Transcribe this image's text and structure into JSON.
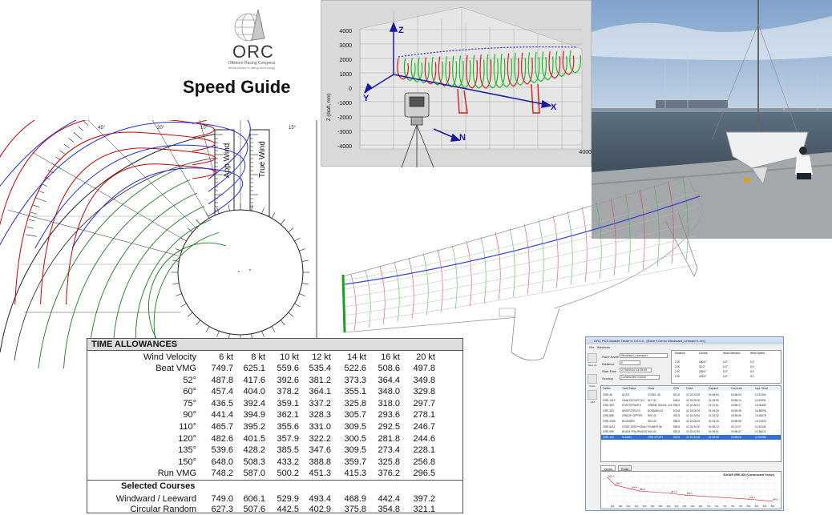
{
  "logo": {
    "brand": "ORC",
    "line1": "Offshore Racing Congress",
    "line2": "World leader in rating technology"
  },
  "title": "Speed Guide",
  "polar": {
    "angle_labels": [
      "45°",
      "20°",
      "10°",
      "15°"
    ],
    "scale_labels": [
      "App Wind",
      "True Wind"
    ],
    "colors": {
      "wind_speed_curves": "#cc0000",
      "angle_curves": "#1a7a1a",
      "apparent_curves": "#1e2fd0"
    }
  },
  "scan": {
    "axis_z_title": "Z (draft, mm)",
    "y_ticks": [
      "4000",
      "3000",
      "2000",
      "1000",
      "0",
      "-1000",
      "-2000",
      "-3000",
      "-4000"
    ],
    "corner_tick": "4000",
    "axes": [
      "Z",
      "Y",
      "X",
      "N"
    ]
  },
  "time_allowances": {
    "header": "TIME ALLOWANCES",
    "wind_velocity_label": "Wind Velocity",
    "wind_speeds": [
      "6 kt",
      "8 kt",
      "10 kt",
      "12 kt",
      "14 kt",
      "16 kt",
      "20 kt"
    ],
    "rows": [
      {
        "label": "Beat VMG",
        "values": [
          "749.7",
          "625.1",
          "559.6",
          "535.4",
          "522.6",
          "508.6",
          "497.8"
        ]
      },
      {
        "label": "52°",
        "values": [
          "487.8",
          "417.6",
          "392.6",
          "381.2",
          "373.3",
          "364.4",
          "349.8"
        ]
      },
      {
        "label": "60°",
        "values": [
          "457.4",
          "404.0",
          "378.2",
          "364.1",
          "355.1",
          "348.0",
          "329.8"
        ]
      },
      {
        "label": "75°",
        "values": [
          "436.5",
          "392.4",
          "359.1",
          "337.2",
          "325.8",
          "318.0",
          "297.7"
        ]
      },
      {
        "label": "90°",
        "values": [
          "441.4",
          "394.9",
          "362.1",
          "328.3",
          "305.7",
          "293.6",
          "278.1"
        ]
      },
      {
        "label": "110°",
        "values": [
          "465.7",
          "395.2",
          "355.6",
          "331.0",
          "309.5",
          "292.5",
          "246.7"
        ]
      },
      {
        "label": "120°",
        "values": [
          "482.6",
          "401.5",
          "357.9",
          "322.2",
          "300.5",
          "281.8",
          "244.6"
        ]
      },
      {
        "label": "135°",
        "values": [
          "539.6",
          "428.2",
          "385.5",
          "347.6",
          "309.5",
          "273.4",
          "228.1"
        ]
      },
      {
        "label": "150°",
        "values": [
          "648.0",
          "508.3",
          "433.2",
          "388.8",
          "359.7",
          "325.8",
          "256.8"
        ]
      },
      {
        "label": "Run VMG",
        "values": [
          "748.2",
          "587.0",
          "500.2",
          "451.3",
          "415.3",
          "376.2",
          "296.5"
        ]
      }
    ],
    "selected_header": "Selected Courses",
    "selected_rows": [
      {
        "label": "Windward / Leeward",
        "values": [
          "749.0",
          "606.1",
          "529.9",
          "493.4",
          "468.9",
          "442.4",
          "397.2"
        ]
      },
      {
        "label": "Circular Random",
        "values": [
          "627.3",
          "507.6",
          "442.5",
          "402.9",
          "375.8",
          "354.8",
          "321.1"
        ]
      }
    ]
  },
  "software": {
    "title": "ORC PCS Module Tester in 1.0.0.0 - [Race 0 Demo Windward_Leeward 1.orc]",
    "menu": [
      "File",
      "Windows"
    ],
    "side_buttons": [
      "Save As",
      "Score",
      "Add"
    ],
    "fields": [
      {
        "label": "Race Name",
        "value": "Windward_Leeward 1"
      },
      {
        "label": "Distance",
        "value": "0"
      },
      {
        "label": "Start Time",
        "value": "27/06/2012 14:25:00"
      },
      {
        "label": "Scoring",
        "value": "Constructed Course"
      }
    ],
    "course_headers": [
      "Distance",
      "Course",
      "Wind Direction",
      "Wind Speed"
    ],
    "course_rows": [
      [
        "2,00",
        "180,0°",
        "0,0°",
        "0,0"
      ],
      [
        "2,00",
        "32,0°",
        "0,0°",
        "0,0"
      ],
      [
        "2,00",
        "209,0°",
        "0,0°",
        "0,0"
      ],
      [
        "2,00",
        "129,0°",
        "0,0°",
        "0,0"
      ]
    ],
    "grid_headers": [
      "SailNo",
      "Yacht Name",
      "Class",
      "GPH",
      "Finish",
      "Elapsed",
      "Corrected",
      "Impl. Wind"
    ],
    "grid_rows": [
      [
        "GRE-46",
        "ACEO",
        "COSEL 46",
        "513,9",
        "42 15:33:38",
        "01:08:54",
        "00:56:03",
        "13,67464"
      ],
      [
        "GRE-1212",
        "GAIA ECOLETTA 3",
        "SLY 40",
        "548,6",
        "42 15:35:00",
        "01:03:50",
        "00:56:14",
        "11,52831"
      ],
      [
        "GRE-363",
        "KOSTOFRAIS II",
        "GRAND SOLEIL 415",
        "556,5",
        "42 15:38:21",
        "01:12:51",
        "00:56:17",
        "15,30456"
      ],
      [
        "GRE-353",
        "ARISTOTELES",
        "BODMAN 42",
        "576,8",
        "42 15:26:39",
        "01:04:25",
        "00:55:46",
        "16,58295"
      ],
      [
        "GRE-888",
        "GRACE+OPPER",
        "IMX-40",
        "591,8",
        "42 15:28:52",
        "01:03:32",
        "00:55:56",
        "15,45678"
      ],
      [
        "GRE-2006",
        "BLIZZARD",
        "IMX-40",
        "585,9",
        "42 15:28:28",
        "01:04:18",
        "00:55:58",
        "15,72532"
      ],
      [
        "GRE-6211",
        "CODE ZERO+DEAN",
        "FILIMER 38",
        "585,8",
        "42 15:34:30",
        "01:09:13",
        "01:01:07",
        "11,50428"
      ],
      [
        "GRE-555",
        "BLADE+PALIPAGOS",
        "IMX-40",
        "583,8",
        "42 15:32:51",
        "01:06:51",
        "00:58:47",
        "12,58211"
      ],
      [
        "GRE-400",
        "SUGAR",
        "GRE SPORT",
        "609,5",
        "42 15:33:36",
        "01:08:59",
        "00:58:06",
        "11,59458"
      ]
    ],
    "tabs": [
      "Vector",
      "Polar"
    ],
    "chart_title": "SUGAR GRE-400 (Constructed Vector)",
    "chart_colors": {
      "line": "#d62020"
    }
  },
  "chart_data": {
    "type": "line",
    "title": "SUGAR GRE-400 (Constructed Vector)",
    "x": [
      440,
      460,
      500,
      520,
      600,
      640,
      800,
      860
    ],
    "series": [
      {
        "values": [
          695.1,
          596.7,
          544.4,
          520.2,
          487.4,
          463.1,
          410.1,
          384.2
        ]
      }
    ],
    "x_ticks": [
      "460",
      "480",
      "500",
      "520",
      "540",
      "560",
      "580",
      "600",
      "620",
      "640",
      "660",
      "680",
      "700",
      "720",
      "740",
      "760",
      "780",
      "800",
      "820",
      "840",
      "860"
    ],
    "grid": true
  }
}
